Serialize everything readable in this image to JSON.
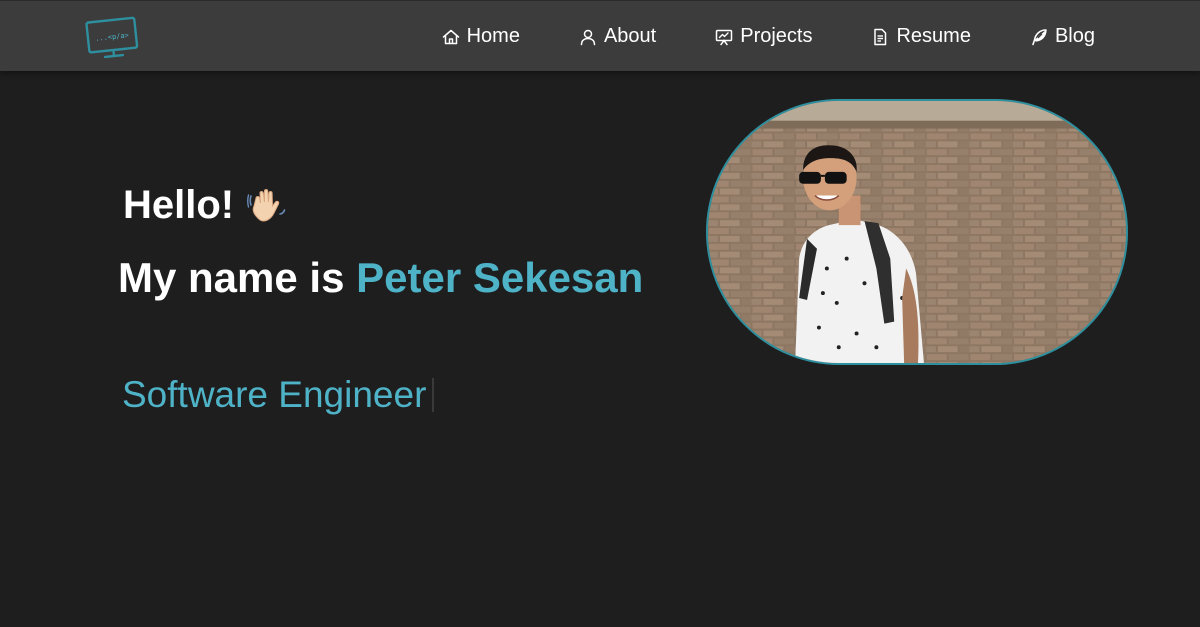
{
  "nav": {
    "logo_icon": "monitor-code-logo-icon",
    "logo_text": "...<p/a>",
    "items": [
      {
        "label": "Home",
        "icon": "home-icon"
      },
      {
        "label": "About",
        "icon": "user-icon"
      },
      {
        "label": "Projects",
        "icon": "presentation-icon"
      },
      {
        "label": "Resume",
        "icon": "document-icon"
      },
      {
        "label": "Blog",
        "icon": "feather-icon"
      }
    ]
  },
  "hero": {
    "greeting": "Hello!",
    "greeting_emoji": "waving-hand-icon",
    "intro_prefix": "My name is",
    "name": "Peter Sekesan",
    "role": "Software Engineer"
  },
  "colors": {
    "background": "#1e1e1f",
    "navbar": "#3c3c3c",
    "accent": "#4fb3c8",
    "photo_border": "#2e8f9e"
  }
}
